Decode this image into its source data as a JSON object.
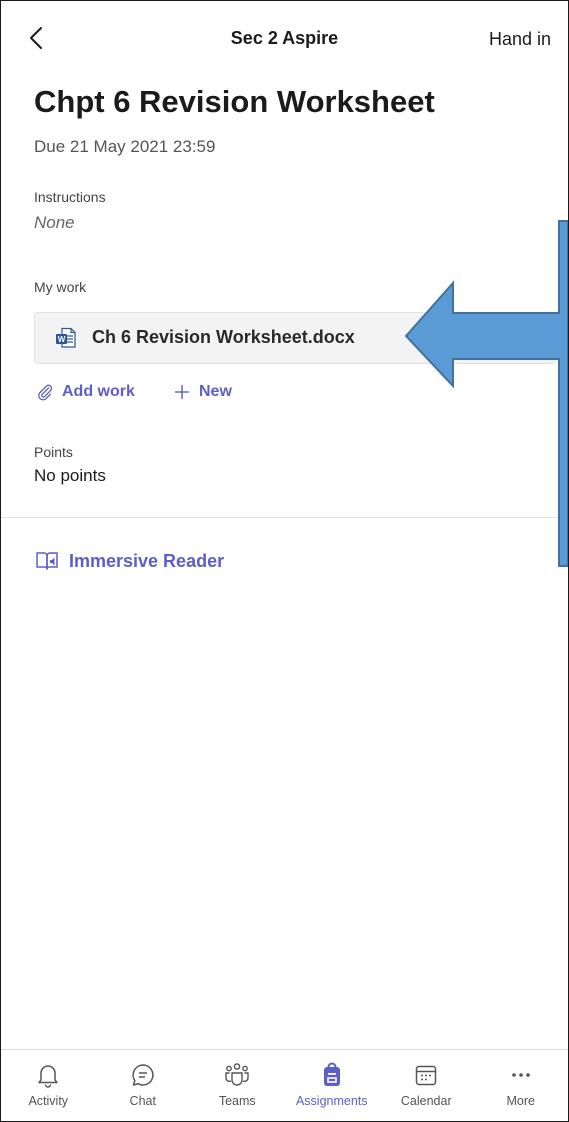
{
  "header": {
    "title": "Sec 2 Aspire",
    "action": "Hand in"
  },
  "assignment": {
    "title": "Chpt 6 Revision Worksheet",
    "due": "Due 21 May 2021 23:59",
    "instructions_label": "Instructions",
    "instructions_value": "None",
    "my_work_label": "My work",
    "file_name": "Ch 6 Revision Worksheet.docx",
    "add_work": "Add work",
    "new": "New",
    "points_label": "Points",
    "points_value": "No points",
    "immersive_reader": "Immersive Reader"
  },
  "nav": {
    "activity": "Activity",
    "chat": "Chat",
    "teams": "Teams",
    "assignments": "Assignments",
    "calendar": "Calendar",
    "more": "More"
  },
  "colors": {
    "accent": "#5b5fc7",
    "arrow_fill": "#5b9bd5",
    "arrow_stroke": "#41719c",
    "word_blue": "#2b579a"
  },
  "icons": [
    "back-chevron-icon",
    "word-doc-icon",
    "paperclip-icon",
    "plus-icon",
    "immersive-reader-icon",
    "bell-icon",
    "chat-icon",
    "teams-icon",
    "assignments-icon",
    "calendar-icon",
    "more-icon"
  ]
}
